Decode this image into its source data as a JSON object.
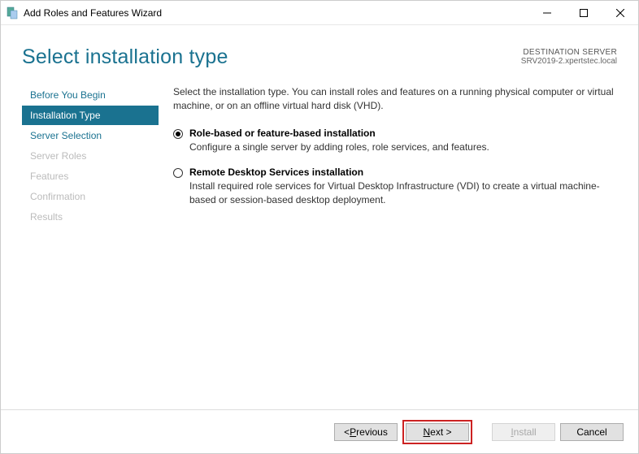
{
  "titlebar": {
    "title": "Add Roles and Features Wizard"
  },
  "header": {
    "page_title": "Select installation type",
    "dest_label": "DESTINATION SERVER",
    "dest_server": "SRV2019-2.xpertstec.local"
  },
  "sidebar": {
    "items": [
      {
        "label": "Before You Begin",
        "state": "normal"
      },
      {
        "label": "Installation Type",
        "state": "selected"
      },
      {
        "label": "Server Selection",
        "state": "normal"
      },
      {
        "label": "Server Roles",
        "state": "disabled"
      },
      {
        "label": "Features",
        "state": "disabled"
      },
      {
        "label": "Confirmation",
        "state": "disabled"
      },
      {
        "label": "Results",
        "state": "disabled"
      }
    ]
  },
  "content": {
    "intro": "Select the installation type. You can install roles and features on a running physical computer or virtual machine, or on an offline virtual hard disk (VHD).",
    "options": [
      {
        "title": "Role-based or feature-based installation",
        "desc": "Configure a single server by adding roles, role services, and features.",
        "checked": true
      },
      {
        "title": "Remote Desktop Services installation",
        "desc": "Install required role services for Virtual Desktop Infrastructure (VDI) to create a virtual machine-based or session-based desktop deployment.",
        "checked": false
      }
    ]
  },
  "footer": {
    "prev_prefix": "< ",
    "prev_u": "P",
    "prev_rest": "revious",
    "next_u": "N",
    "next_rest": "ext >",
    "install_u": "I",
    "install_rest": "nstall",
    "cancel": "Cancel"
  }
}
